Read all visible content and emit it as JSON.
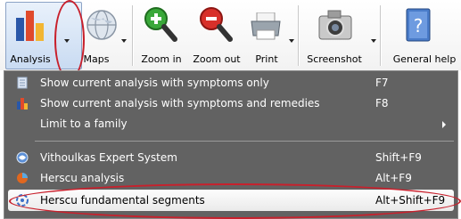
{
  "toolbar": {
    "items": [
      {
        "label": "Analysis",
        "icon": "analysis-chart-icon"
      },
      {
        "label": "Maps",
        "icon": "globe-icon"
      },
      {
        "label": "Zoom in",
        "icon": "zoom-in-icon"
      },
      {
        "label": "Zoom out",
        "icon": "zoom-out-icon"
      },
      {
        "label": "Print",
        "icon": "printer-icon"
      },
      {
        "label": "Screenshot",
        "icon": "camera-icon"
      },
      {
        "label": "General help",
        "icon": "help-book-icon"
      }
    ]
  },
  "menu": {
    "items": [
      {
        "label": "Show current analysis with symptoms only",
        "shortcut": "F7",
        "icon": "document-icon"
      },
      {
        "label": "Show current analysis with symptoms and remedies",
        "shortcut": "F8",
        "icon": "analysis-chart-icon"
      },
      {
        "label": "Limit to a family",
        "shortcut": "",
        "icon": "",
        "submenu": true
      },
      {
        "label": "Vithoulkas Expert System",
        "shortcut": "Shift+F9",
        "icon": "expert-system-icon"
      },
      {
        "label": "Herscu analysis",
        "shortcut": "Alt+F9",
        "icon": "herscu-icon"
      },
      {
        "label": "Herscu fundamental segments",
        "shortcut": "Alt+Shift+F9",
        "icon": "segments-icon"
      }
    ]
  },
  "colors": {
    "menu_bg": "#626262",
    "highlight": "#c8202c",
    "button_bg": "#c9dbf2"
  }
}
